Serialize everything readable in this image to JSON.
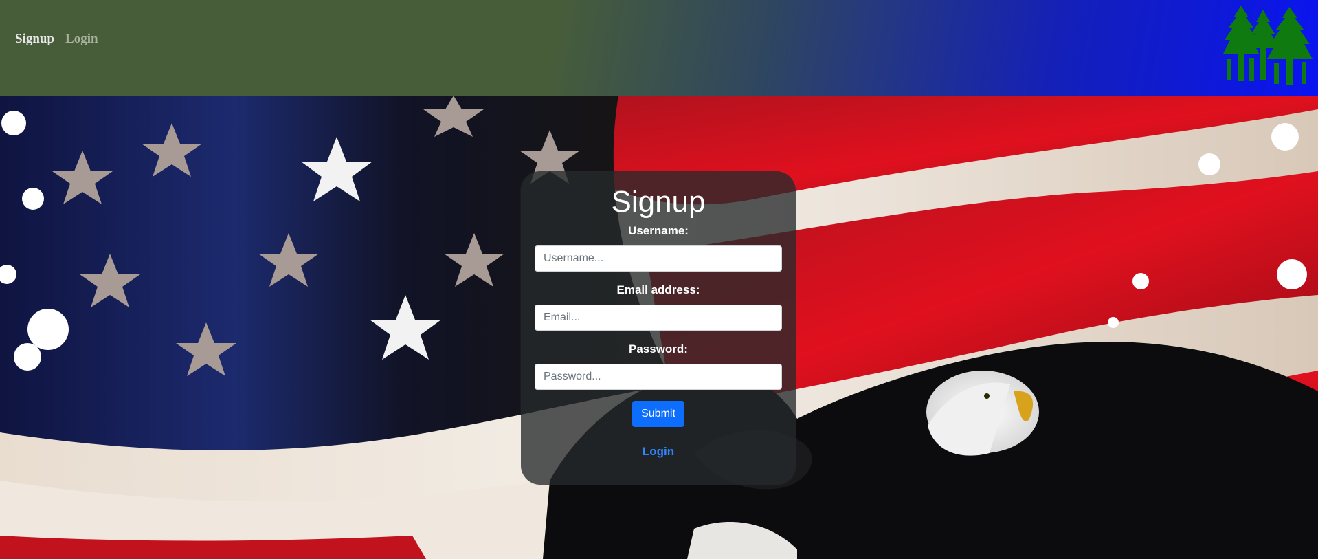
{
  "header": {
    "nav": [
      {
        "label": "Signup",
        "active": true
      },
      {
        "label": "Login",
        "active": false
      }
    ],
    "logo_icon": "pine-trees-icon",
    "logo_color": "#0f7a10"
  },
  "background": {
    "description_icon": "us-flag-and-eagle-image"
  },
  "form": {
    "title": "Signup",
    "username_label": "Username:",
    "username_placeholder": "Username...",
    "username_value": "",
    "email_label": "Email address:",
    "email_placeholder": "Email...",
    "email_value": "",
    "password_label": "Password:",
    "password_placeholder": "Password...",
    "password_value": "",
    "submit_label": "Submit",
    "login_link": "Login",
    "accent_color": "#0d6efd"
  }
}
